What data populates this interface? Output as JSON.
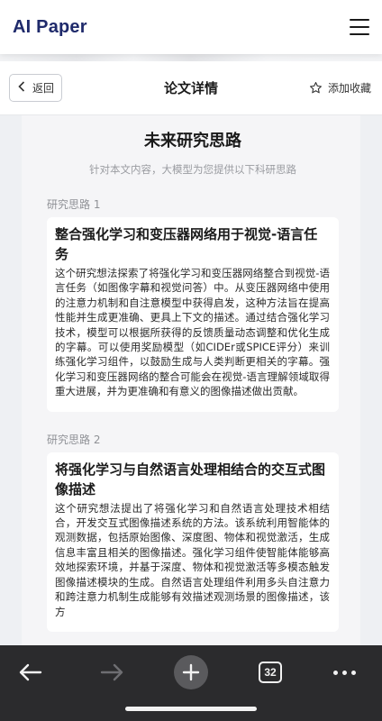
{
  "app": {
    "logo": "AI Paper",
    "menu_icon": "hamburger-menu-icon"
  },
  "subheader": {
    "back_label": "返回",
    "title": "论文详情",
    "favorite_label": "添加收藏"
  },
  "section": {
    "title": "未来研究思路",
    "subtitle": "针对本文内容，大模型为您提供以下科研思路"
  },
  "ideas": [
    {
      "label": "研究思路 1",
      "title": "整合强化学习和变压器网络用于视觉-语言任务",
      "body": "这个研究想法探索了将强化学习和变压器网络整合到视觉-语言任务（如图像字幕和视觉问答）中。从变压器网络中使用的注意力机制和自注意模型中获得启发，这种方法旨在提高性能并生成更准确、更具上下文的描述。通过结合强化学习技术，模型可以根据所获得的反馈质量动态调整和优化生成的字幕。可以使用奖励模型（如CIDEr或SPICE评分）来训练强化学习组件，以鼓励生成与人类判断更相关的字幕。强化学习和变压器网络的整合可能会在视觉-语言理解领域取得重大进展，并为更准确和有意义的图像描述做出贡献。"
    },
    {
      "label": "研究思路 2",
      "title": "将强化学习与自然语言处理相结合的交互式图像描述",
      "body": "这个研究想法提出了将强化学习和自然语言处理技术相结合，开发交互式图像描述系统的方法。该系统利用智能体的观测数据，包括原始图像、深度图、物体和视觉激活，生成信息丰富且相关的图像描述。强化学习组件使智能体能够高效地探索环境，并基于深度、物体和视觉激活等多模态触发图像描述模块的生成。自然语言处理组件利用多头自注意力和跨注意力机制生成能够有效描述观测场景的图像描述，该方"
    }
  ],
  "browser_bar": {
    "tab_count": "32",
    "icons": [
      "back-arrow-icon",
      "forward-arrow-icon",
      "plus-icon",
      "tabs-icon",
      "more-dots-icon"
    ],
    "forward_enabled": false
  },
  "colors": {
    "logo": "#1f2a6b",
    "page_bg": "#eef0f3",
    "card_bg": "#f5f5f7",
    "bar_bg": "#2b2b2d"
  }
}
